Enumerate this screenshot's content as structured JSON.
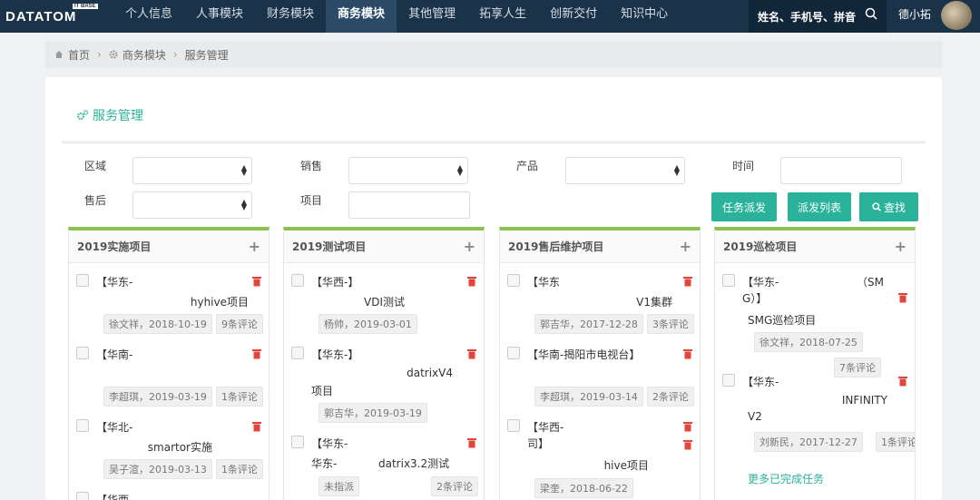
{
  "brand": {
    "logo": "DATATOM",
    "badge": "IT BASE"
  },
  "nav": {
    "items": [
      "个人信息",
      "人事模块",
      "财务模块",
      "商务模块",
      "其他管理",
      "拓享人生",
      "创新交付",
      "知识中心"
    ],
    "active": 3
  },
  "search": {
    "placeholder": "姓名、手机号、拼音"
  },
  "user": {
    "name": "德小拓"
  },
  "breadcrumb": {
    "home": "首页",
    "module": "商务模块",
    "page": "服务管理"
  },
  "page": {
    "title": "服务管理"
  },
  "filters": {
    "region": "区域",
    "sales": "销售",
    "product": "产品",
    "time": "时间",
    "aftersales": "售后",
    "project": "项目"
  },
  "buttons": {
    "assign": "任务派发",
    "list": "派发列表",
    "search": "查找"
  },
  "columns": [
    {
      "title": "2019实施项目",
      "tasks": [
        {
          "line1": "【华东-",
          "line2": "hyhive项目",
          "owner": "徐文祥，2018-10-19",
          "comments": "9条评论"
        },
        {
          "line1": "【华南-",
          "line2": "",
          "owner": "李超琪，2019-03-19",
          "comments": "1条评论"
        },
        {
          "line1": "【华北-",
          "line2": "smartor实施",
          "owner": "吴子渲，2019-03-13",
          "comments": "1条评论"
        },
        {
          "line1": "【华西-",
          "line2": "",
          "owner": "",
          "comments": ""
        }
      ]
    },
    {
      "title": "2019测试项目",
      "tasks": [
        {
          "line1": "【华西-】",
          "line2": "VDI测试",
          "owner": "杨帅，2019-03-01",
          "comments": ""
        },
        {
          "line1": "【华东-】",
          "line2": "datrixV4",
          "line3": "项目",
          "owner": "郭吉华，2019-03-19",
          "comments": ""
        },
        {
          "line1": "【华东-",
          "line2": "华东-",
          "line2b": "datrix3.2测试",
          "owner": "未指派",
          "comments": "2条评论"
        }
      ]
    },
    {
      "title": "2019售后维护项目",
      "tasks": [
        {
          "line1": "【华东",
          "line2": "V1集群",
          "owner": "郭吉华，2017-12-28",
          "comments": "3条评论"
        },
        {
          "line1": "【华南-揭阳市电视台】",
          "line2": "",
          "owner": "李超琪，2019-03-14",
          "comments": "2条评论"
        },
        {
          "line1": "【华西-",
          "line1b": "司】",
          "line2": "hive项目",
          "owner": "梁奎，2018-06-22",
          "comments": ""
        }
      ]
    },
    {
      "title": "2019巡检项目",
      "tasks": [
        {
          "line1": "【华东-",
          "line1b": "（SM",
          "line1c": "G）】",
          "line2": "SMG巡检项目",
          "owner": "徐文祥，2018-07-25",
          "comments": "7条评论"
        },
        {
          "line1": "【华东-",
          "line2": "INFINITY",
          "line3": "V2",
          "owner": "刘新民，2017-12-27",
          "comments": "1条评论"
        }
      ],
      "more": "更多已完成任务"
    }
  ],
  "colors": {
    "nav": "#1b3349",
    "accent": "#2bb29a",
    "column_top": "#8cc152",
    "delete": "#e2463a"
  }
}
